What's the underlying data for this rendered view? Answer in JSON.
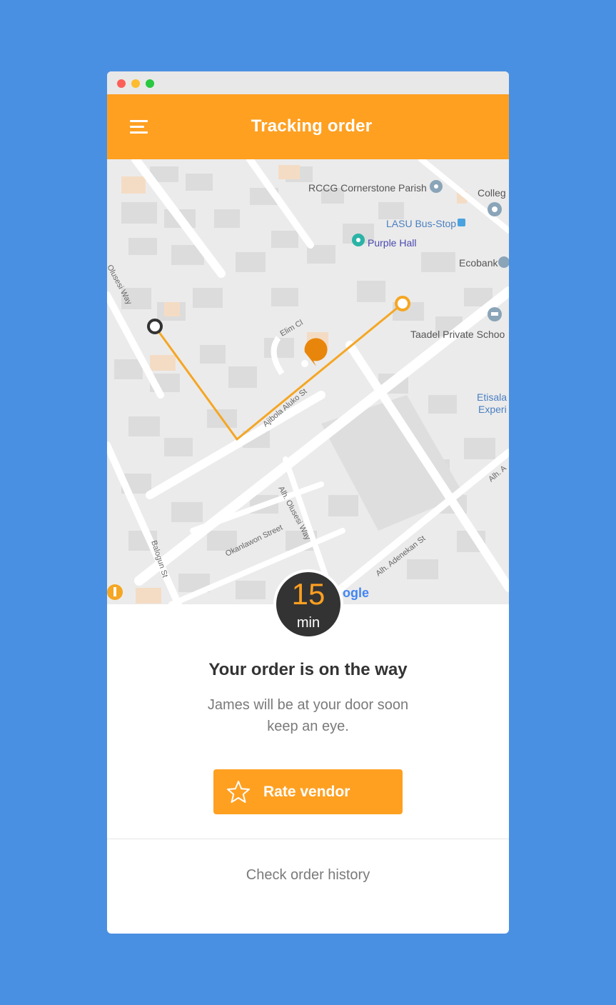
{
  "app": {
    "title": "Tracking order"
  },
  "colors": {
    "accent": "#ffa021",
    "background": "#4a90e2",
    "dark": "#333333"
  },
  "map": {
    "labels": {
      "rccg": "RCCG Cornerstone Parish",
      "college": "Colleg",
      "lasu": "LASU Bus-Stop",
      "purple_hall": "Purple Hall",
      "ecobank": "Ecobank",
      "olusesi": "Olusesi Way",
      "taadel": "Taadel Private Schoo",
      "elim": "Elim Cl",
      "ajibola": "Ajibola Aluko St",
      "etisalat1": "Etisala",
      "etisalat2": "Experi",
      "alh_right": "Alh. A",
      "alh_olusesi": "Alh. Olusesi Way",
      "okanlawon": "Okanlawon Street",
      "balogun": "Balogun St",
      "adenekan": "Alh. Adenekan St",
      "google": "ogle"
    },
    "icons": {
      "place": "place-pin-icon",
      "bus": "bus-stop-icon",
      "school": "school-icon",
      "restaurant": "restaurant-icon"
    }
  },
  "eta": {
    "value": "15",
    "unit": "min"
  },
  "status": {
    "headline": "Your order is on the way",
    "line1": "James will be at your door soon",
    "line2": "keep an eye."
  },
  "actions": {
    "rate_label": "Rate vendor",
    "history_label": "Check order history"
  }
}
